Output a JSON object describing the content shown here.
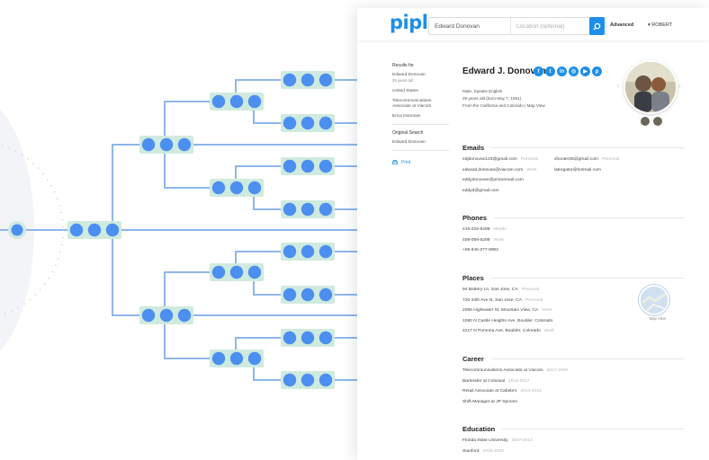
{
  "brand": {
    "logo": "pipl",
    "accent": "#1d8fe8"
  },
  "search": {
    "name_value": "Edward Donovan",
    "location_placeholder": "Location (optional)"
  },
  "topbar": {
    "advanced_label": "Advanced",
    "user_label": "▾ ROBERT"
  },
  "sidebar": {
    "results_heading": "Results for",
    "results": [
      {
        "text": "Edward Donovan",
        "sub": "29 years old"
      },
      {
        "text": "United States"
      },
      {
        "text": "Telecommunications Associate at Viacom"
      },
      {
        "text": "Erica Donovan"
      }
    ],
    "original_heading": "Original Search",
    "original_value": "Edward Donovan",
    "print_label": "Print"
  },
  "profile": {
    "name": "Edward J. Donovan",
    "socials": [
      "facebook-icon",
      "twitter-icon",
      "linkedin-icon",
      "instagram-icon",
      "youtube-icon",
      "pinterest-icon"
    ],
    "meta": [
      "Male, Speaks English",
      "29 years old (born May 7, 1991)",
      "From the California and Colorado | Map View"
    ]
  },
  "emails": {
    "title": "Emails",
    "left": [
      {
        "value": "edjdonovan123@gmail.com",
        "tag": "Personal"
      },
      {
        "value": "edward.donovan@viacom.com",
        "tag": "Work"
      },
      {
        "value": "eddydonovan@protonmail.com",
        "tag": ""
      },
      {
        "value": "eddyd@gmail.com",
        "tag": ""
      }
    ],
    "right": [
      {
        "value": "shooter35@gmail.com",
        "tag": "Personal"
      },
      {
        "value": "latergator@hotmail.com",
        "tag": ""
      }
    ]
  },
  "phones": {
    "title": "Phones",
    "items": [
      {
        "value": "415-225-6298",
        "tag": "Mobile"
      },
      {
        "value": "408-059-5298",
        "tag": "Work"
      },
      {
        "value": "+86 845-277-8902",
        "tag": ""
      }
    ]
  },
  "places": {
    "title": "Places",
    "map_label": "Map View",
    "items": [
      {
        "value": "94 Battery Ln, San Jose, CA",
        "tag": "Personal"
      },
      {
        "value": "720 44th Ave N, San Jose, CA",
        "tag": "Personal"
      },
      {
        "value": "2006 Highwater St, Mountain View, CA",
        "tag": "Work"
      },
      {
        "value": "1080 N Castle Heights Ave, Boulder, Colorado",
        "tag": ""
      },
      {
        "value": "4217 N Pomona Ave, Boulder, Colorado",
        "tag": "Work"
      }
    ]
  },
  "career": {
    "title": "Career",
    "items": [
      {
        "value": "Telecommunications Associate at Viacom",
        "tag": "2017-2020"
      },
      {
        "value": "Bartender at Colossal",
        "tag": "2016-2017"
      },
      {
        "value": "Retail Associate at Cabela's",
        "tag": "2014-2016"
      },
      {
        "value": "Shift Manager at JP Spoons",
        "tag": ""
      }
    ]
  },
  "education": {
    "title": "Education",
    "items": [
      {
        "value": "Florida State University",
        "tag": "2007-2012"
      },
      {
        "value": "Stanford",
        "tag": "2019-2020"
      }
    ]
  }
}
